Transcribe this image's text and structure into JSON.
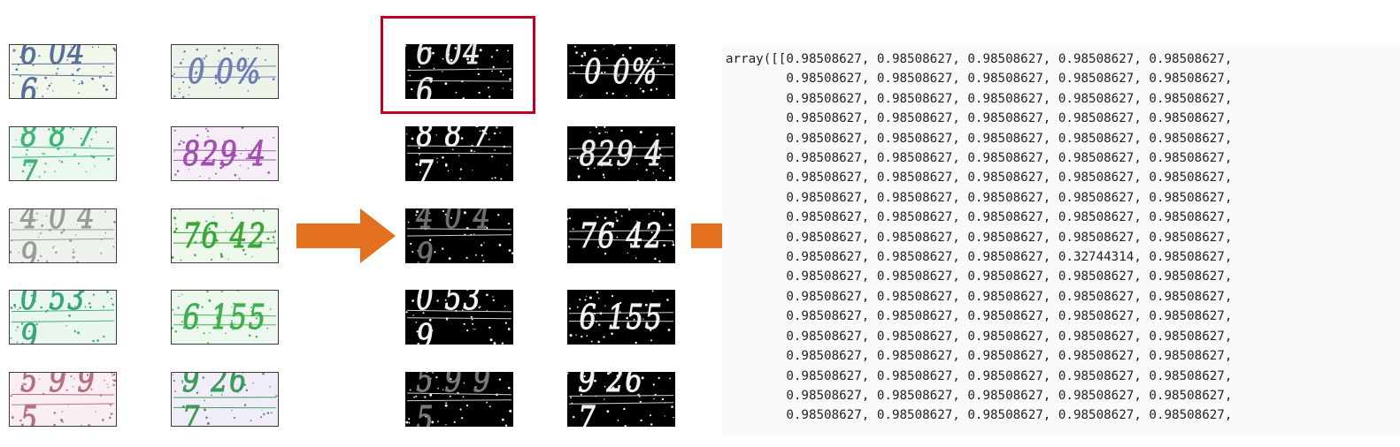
{
  "original_captchas": {
    "col1": [
      {
        "text": "6 04 6",
        "color": "#5a6f9a",
        "bg": "#f1f7ea"
      },
      {
        "text": "8 8 7 7",
        "color": "#3fb579",
        "bg": "#ecf7f0"
      },
      {
        "text": "4 0 4 9",
        "color": "#9a9a9a",
        "bg": "#eef2ec"
      },
      {
        "text": "0 53 9",
        "color": "#3aa680",
        "bg": "#eaf7ef"
      },
      {
        "text": "5 9 9 5",
        "color": "#b5707a",
        "bg": "#f8eef3"
      }
    ],
    "col2": [
      {
        "text": "0 0%",
        "color": "#6f7fb5",
        "bg": "#eef3ea"
      },
      {
        "text": "829 4",
        "color": "#a34fb0",
        "bg": "#f5eef6"
      },
      {
        "text": "76 42",
        "color": "#3aa63a",
        "bg": "#eef8ec"
      },
      {
        "text": "6 155",
        "color": "#3fae50",
        "bg": "#ecf8ee"
      },
      {
        "text": "9 26 7",
        "color": "#3e9a5a",
        "bg": "#f1edf8"
      }
    ]
  },
  "binarized_captchas": {
    "col1": [
      {
        "text": "6 04 6",
        "color": "#e6e6e6"
      },
      {
        "text": "8 8 7 7",
        "color": "#f2f2f2"
      },
      {
        "text": "4 0 4 9",
        "color": "#6e6e6e"
      },
      {
        "text": "0 53 9",
        "color": "#f2f2f2"
      },
      {
        "text": "5 9 9 5",
        "color": "#7a7a7a"
      }
    ],
    "col2": [
      {
        "text": "0 0%",
        "color": "#f2f2f2"
      },
      {
        "text": "829 4",
        "color": "#ececec"
      },
      {
        "text": "76 42",
        "color": "#f2f2f2"
      },
      {
        "text": "6 155",
        "color": "#f2f2f2"
      },
      {
        "text": "9 26 7",
        "color": "#f2f2f2"
      }
    ]
  },
  "colors": {
    "arrow": "#e2701f",
    "highlight": "#c00020"
  },
  "array_output": {
    "prefix": "array([[",
    "values": [
      [
        "0.98508627",
        "0.98508627",
        "0.98508627",
        "0.98508627",
        "0.98508627"
      ],
      [
        "0.98508627",
        "0.98508627",
        "0.98508627",
        "0.98508627",
        "0.98508627"
      ],
      [
        "0.98508627",
        "0.98508627",
        "0.98508627",
        "0.98508627",
        "0.98508627"
      ],
      [
        "0.98508627",
        "0.98508627",
        "0.98508627",
        "0.98508627",
        "0.98508627"
      ],
      [
        "0.98508627",
        "0.98508627",
        "0.98508627",
        "0.98508627",
        "0.98508627"
      ],
      [
        "0.98508627",
        "0.98508627",
        "0.98508627",
        "0.98508627",
        "0.98508627"
      ],
      [
        "0.98508627",
        "0.98508627",
        "0.98508627",
        "0.98508627",
        "0.98508627"
      ],
      [
        "0.98508627",
        "0.98508627",
        "0.98508627",
        "0.98508627",
        "0.98508627"
      ],
      [
        "0.98508627",
        "0.98508627",
        "0.98508627",
        "0.98508627",
        "0.98508627"
      ],
      [
        "0.98508627",
        "0.98508627",
        "0.98508627",
        "0.98508627",
        "0.98508627"
      ],
      [
        "0.98508627",
        "0.98508627",
        "0.98508627",
        "0.32744314",
        "0.98508627"
      ],
      [
        "0.98508627",
        "0.98508627",
        "0.98508627",
        "0.98508627",
        "0.98508627"
      ],
      [
        "0.98508627",
        "0.98508627",
        "0.98508627",
        "0.98508627",
        "0.98508627"
      ],
      [
        "0.98508627",
        "0.98508627",
        "0.98508627",
        "0.98508627",
        "0.98508627"
      ],
      [
        "0.98508627",
        "0.98508627",
        "0.98508627",
        "0.98508627",
        "0.98508627"
      ],
      [
        "0.98508627",
        "0.98508627",
        "0.98508627",
        "0.98508627",
        "0.98508627"
      ],
      [
        "0.98508627",
        "0.98508627",
        "0.98508627",
        "0.98508627",
        "0.98508627"
      ],
      [
        "0.98508627",
        "0.98508627",
        "0.98508627",
        "0.98508627",
        "0.98508627"
      ],
      [
        "0.98508627",
        "0.98508627",
        "0.98508627",
        "0.98508627",
        "0.98508627"
      ]
    ]
  }
}
